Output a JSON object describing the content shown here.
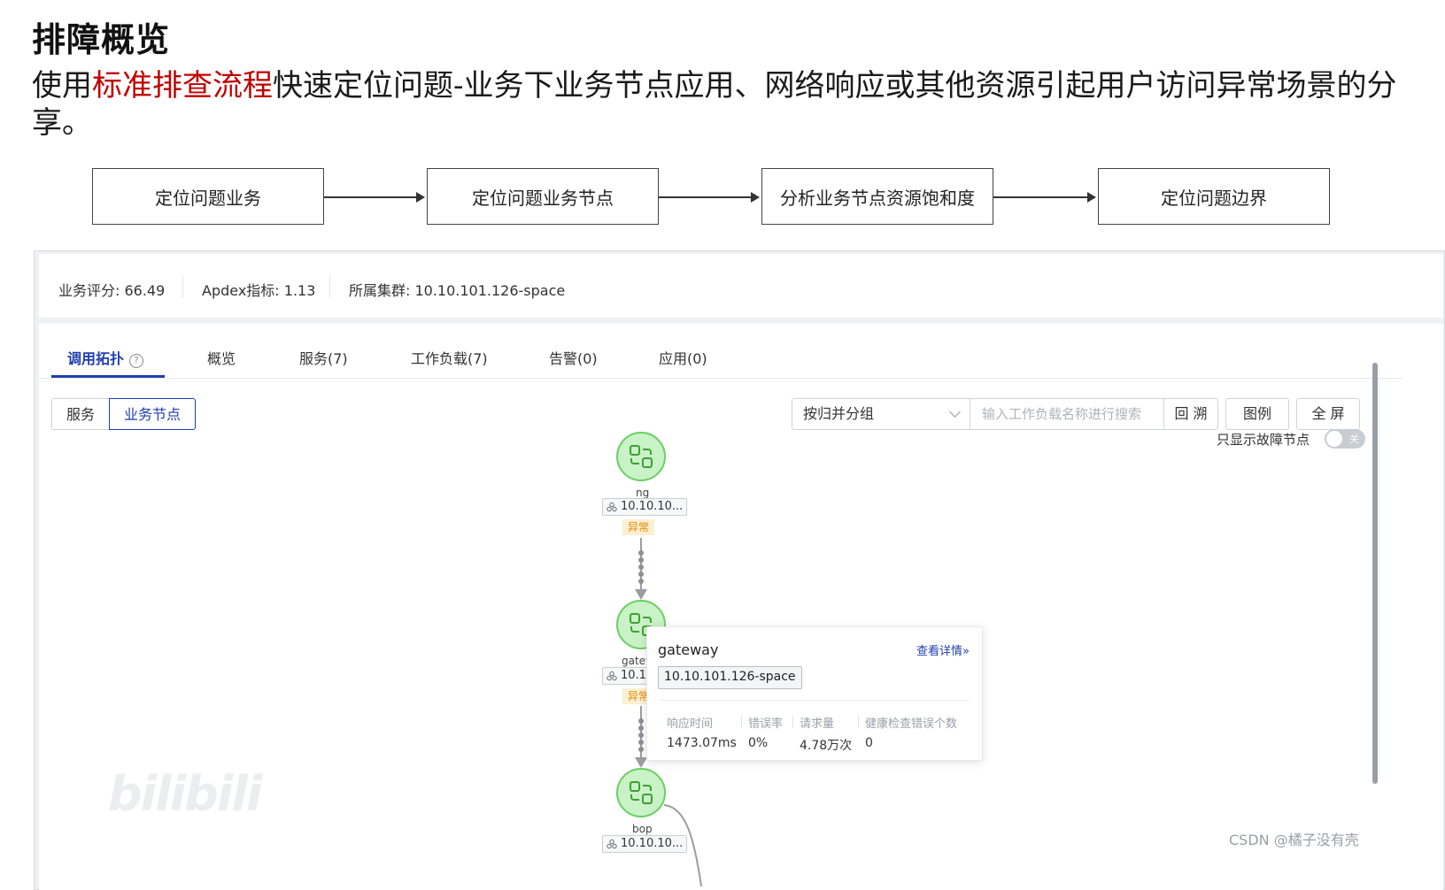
{
  "page": {
    "title": "排障概览",
    "intro_before": "使用",
    "intro_highlight": "标准排查流程",
    "intro_after": "快速定位问题-业务下业务节点应用、网络响应或其他资源引起用户访问异常场景的分享。"
  },
  "flow": {
    "steps": [
      "定位问题业务",
      "定位问题业务节点",
      "分析业务节点资源饱和度",
      "定位问题边界"
    ]
  },
  "summary": {
    "score": "业务评分: 66.49",
    "apdex": "Apdex指标: 1.13",
    "cluster": "所属集群: 10.10.101.126-space"
  },
  "tabs": [
    "调用拓扑",
    "概览",
    "服务(7)",
    "工作负载(7)",
    "告警(0)",
    "应用(0)"
  ],
  "toolbar": {
    "view_service": "服务",
    "view_node": "业务节点",
    "group_select": "按归并分组",
    "search_placeholder": "输入工作负载名称进行搜索",
    "trace_back": "回 溯",
    "legend": "图例",
    "fullscreen": "全 屏",
    "fault_only_label": "只显示故障节点",
    "toggle_text": "关"
  },
  "topology": {
    "nodes": [
      {
        "name": "ng",
        "ip": "10.10.10...",
        "status": "异常"
      },
      {
        "name": "gatew",
        "ip": "10.10",
        "status": "异常"
      },
      {
        "name": "bop",
        "ip": "10.10.10..."
      }
    ]
  },
  "tooltip": {
    "name": "gateway",
    "detail_link": "查看详情»",
    "cluster": "10.10.101.126-space",
    "metrics": [
      {
        "label": "响应时间",
        "value": "1473.07ms"
      },
      {
        "label": "错误率",
        "value": "0%"
      },
      {
        "label": "请求量",
        "value": "4.78万次"
      },
      {
        "label": "健康检查错误个数",
        "value": "0"
      }
    ]
  },
  "watermarks": {
    "bilibili": "bilibili",
    "csdn": "CSDN @橘子没有壳"
  },
  "colors": {
    "accent": "#1f3fae",
    "highlight": "#c00000",
    "node_fill": "#c9f2c6",
    "node_border": "#6bcf61",
    "abnormal_text": "#e58a00",
    "abnormal_bg": "#fdf0d2"
  }
}
